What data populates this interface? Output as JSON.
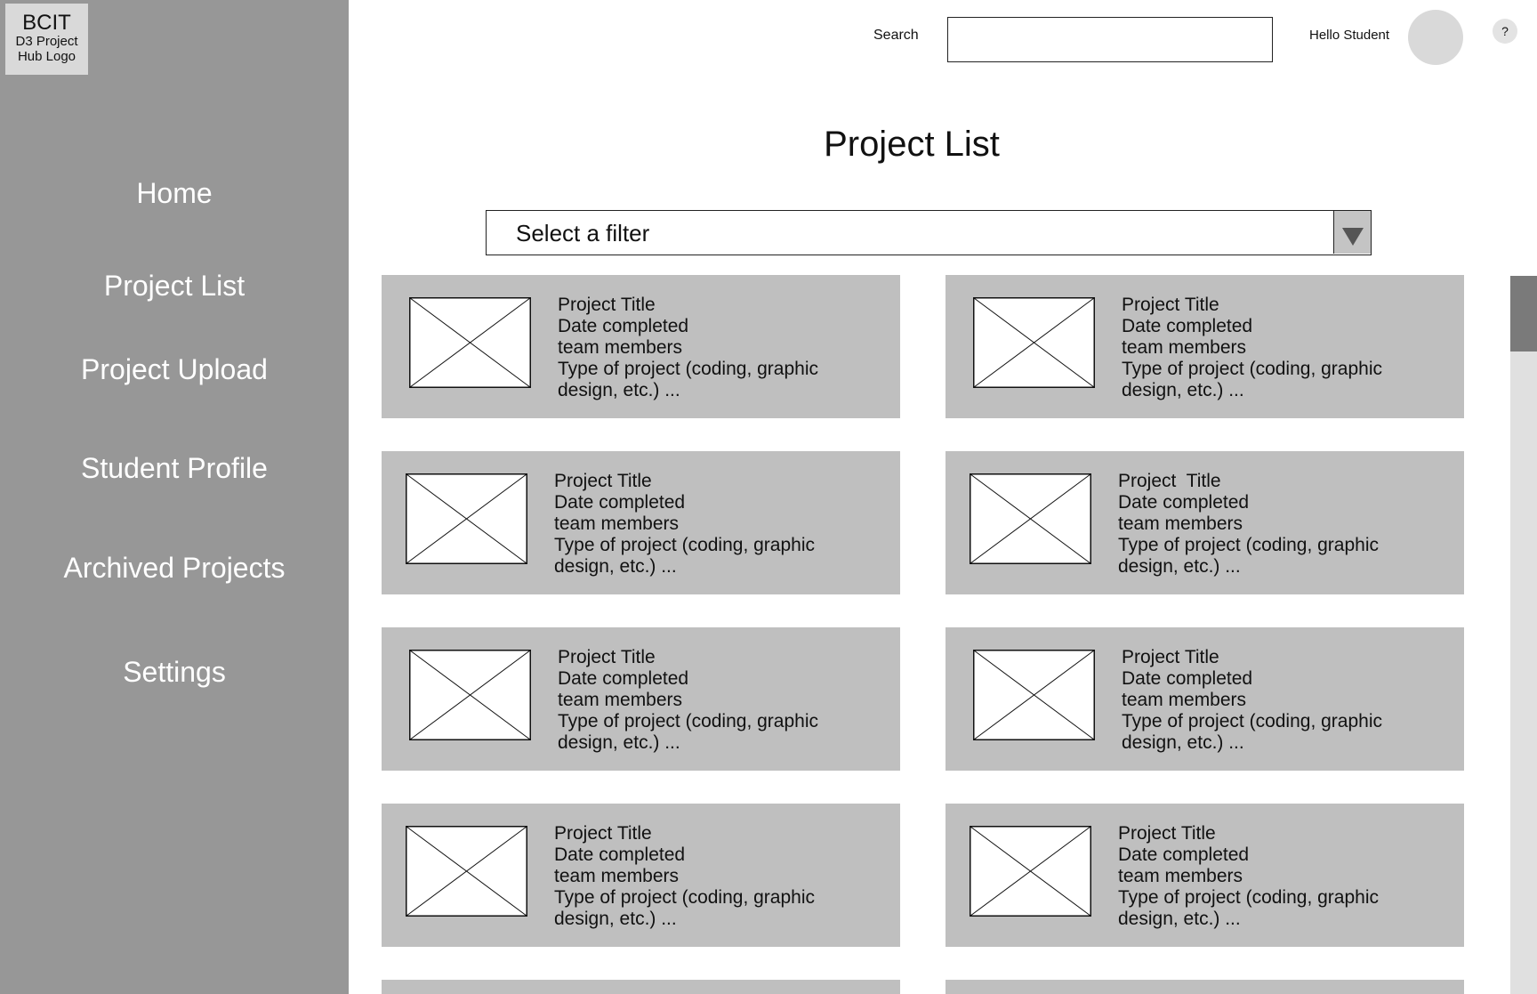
{
  "logo": {
    "line1": "BCIT",
    "line2": "D3 Project",
    "line3": "Hub Logo"
  },
  "nav": {
    "items": [
      {
        "label": "Home"
      },
      {
        "label": "Project List"
      },
      {
        "label": "Project Upload"
      },
      {
        "label": "Student Profile"
      },
      {
        "label": "Archived Projects"
      },
      {
        "label": "Settings"
      }
    ]
  },
  "header": {
    "search_label": "Search",
    "search_value": "",
    "greeting": "Hello Student",
    "help_label": "?"
  },
  "main": {
    "title": "Project List",
    "filter": {
      "selected": "Select a filter"
    }
  },
  "cards": [
    {
      "title": "Project Title",
      "date": "Date completed",
      "members": "team members",
      "type1": "Type of project (coding, graphic",
      "type2": "design, etc.) ..."
    },
    {
      "title": "Project Title",
      "date": "Date completed",
      "members": "team members",
      "type1": "Type of project (coding, graphic",
      "type2": "design, etc.) ..."
    },
    {
      "title": "Project Title",
      "date": "Date completed",
      "members": "team members",
      "type1": "Type of project (coding, graphic",
      "type2": "design, etc.) ..."
    },
    {
      "title": "Project  Title",
      "date": "Date completed",
      "members": "team members",
      "type1": "Type of project (coding, graphic",
      "type2": "design, etc.) ..."
    },
    {
      "title": "Project Title",
      "date": "Date completed",
      "members": "team members",
      "type1": "Type of project (coding, graphic",
      "type2": "design, etc.) ..."
    },
    {
      "title": "Project Title",
      "date": "Date completed",
      "members": "team members",
      "type1": "Type of project (coding, graphic",
      "type2": "design, etc.) ..."
    },
    {
      "title": "Project Title",
      "date": "Date completed",
      "members": "team members",
      "type1": "Type of project (coding, graphic",
      "type2": "design, etc.) ..."
    },
    {
      "title": "Project Title",
      "date": "Date completed",
      "members": "team members",
      "type1": "Type of project (coding, graphic",
      "type2": "design, etc.) ..."
    }
  ],
  "colors": {
    "sidebar": "#979797",
    "card": "#bfbfbf",
    "placeholder": "#d9d9d9"
  }
}
